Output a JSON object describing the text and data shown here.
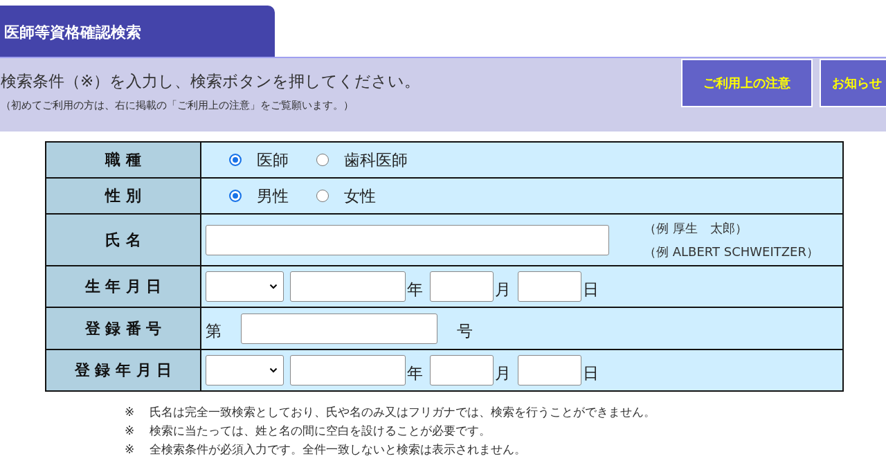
{
  "header": {
    "title": "医師等資格確認検索"
  },
  "instruction": {
    "text": "検索条件（※）を入力し、検索ボタンを押してください。",
    "note": "（初めてご利用の方は、右に掲載の「ご利用上の注意」をご覧願います。）"
  },
  "buttons": [
    "ご利用上の注意",
    "お知らせ"
  ],
  "form": {
    "rows": [
      {
        "kind": "radio",
        "label": "職 種",
        "options": [
          {
            "label": "医師",
            "selected": true
          },
          {
            "label": "歯科医師",
            "selected": false
          }
        ]
      },
      {
        "kind": "radio",
        "label": "性 別",
        "options": [
          {
            "label": "男性",
            "selected": true
          },
          {
            "label": "女性",
            "selected": false
          }
        ]
      },
      {
        "kind": "text",
        "label": "氏 名",
        "examples": [
          "（例 厚生　太郎）",
          "（例 ALBERT SCHWEITZER）"
        ]
      },
      {
        "kind": "date",
        "label": "生 年 月 日",
        "units": [
          "年",
          "月",
          "日"
        ]
      },
      {
        "kind": "number",
        "label": "登 録 番 号",
        "prefix": "第",
        "suffix": "号"
      },
      {
        "kind": "date",
        "label": "登 録 年 月 日",
        "units": [
          "年",
          "月",
          "日"
        ]
      }
    ]
  },
  "notes": [
    {
      "mark": "※",
      "text": "氏名は完全一致検索としており、氏や名のみ又はフリガナでは、検索を行うことができません。"
    },
    {
      "mark": "※",
      "text": "検索に当たっては、姓と名の間に空白を設けることが必要です。"
    },
    {
      "mark": "※",
      "text": "全検索条件が必須入力です。全件一致しないと検索は表示されません。"
    }
  ]
}
